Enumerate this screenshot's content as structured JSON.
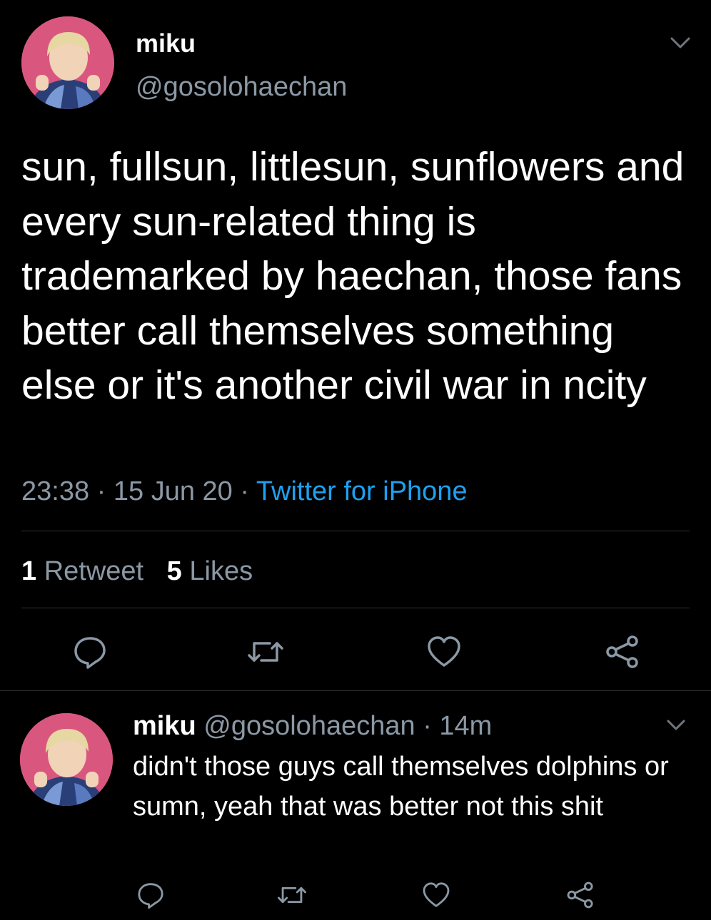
{
  "main_tweet": {
    "display_name": "miku",
    "handle": "@gosolohaechan",
    "text": "sun, fullsun, littlesun, sunflowers and every sun-related thing is trademarked by haechan, those fans better call themselves something else or it's another civil war in ncity",
    "time": "23:38",
    "sep1": "·",
    "date": "15 Jun 20",
    "sep2": "·",
    "source": "Twitter for iPhone",
    "retweet_count": "1",
    "retweet_label": "Retweet",
    "like_count": "5",
    "like_label": "Likes"
  },
  "reply": {
    "display_name": "miku",
    "handle": "@gosolohaechan",
    "sep": "·",
    "age": "14m",
    "text": "didn't those guys call themselves dolphins or sumn, yeah that was better not this shit"
  },
  "icons": {
    "reply": "speech-bubble-icon",
    "retweet": "retweet-arrows-icon",
    "like": "heart-icon",
    "share": "share-icon",
    "more": "chevron-down-icon"
  },
  "colors": {
    "background": "#000000",
    "text": "#ffffff",
    "muted": "#8b98a5",
    "accent": "#1da1f2",
    "avatar_bg": "#d9577e"
  }
}
